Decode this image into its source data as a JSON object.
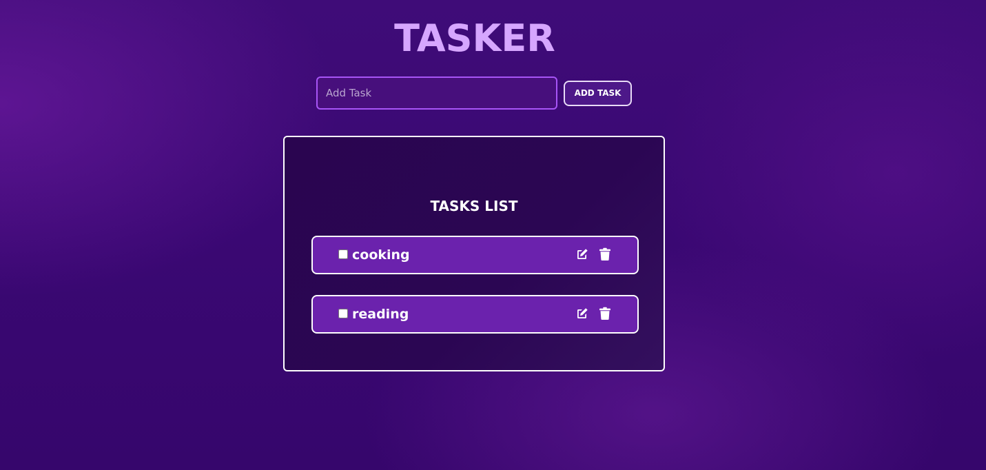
{
  "app": {
    "title": "TASKER"
  },
  "add_bar": {
    "input_value": "",
    "input_placeholder": "Add Task",
    "add_button_label": "ADD TASK"
  },
  "tasks_panel": {
    "title": "TASKS LIST",
    "tasks": [
      {
        "label": "cooking",
        "done": false,
        "edit_icon": "edit-icon",
        "delete_icon": "trash-icon"
      },
      {
        "label": "reading",
        "done": false,
        "edit_icon": "edit-icon",
        "delete_icon": "trash-icon"
      }
    ]
  },
  "colors": {
    "title": "#d6a6ff",
    "input_border": "#a855f7",
    "task_item_bg": "#6b22ad",
    "panel_bg": "#2a0550",
    "page_bg": "#3f0c78"
  }
}
